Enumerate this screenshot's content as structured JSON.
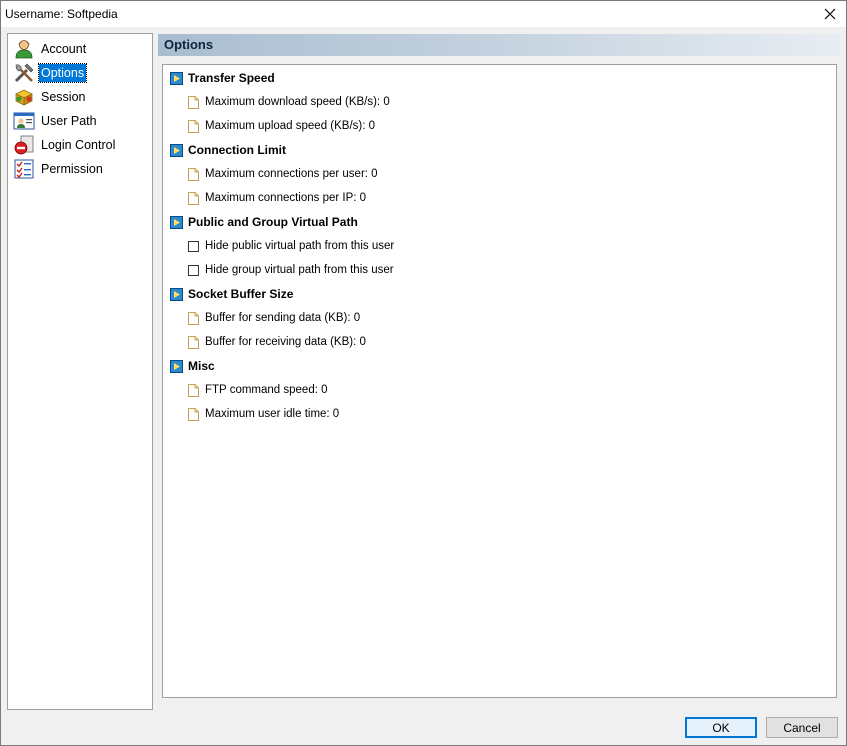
{
  "window": {
    "title": "Username: Softpedia"
  },
  "sidebar": {
    "items": [
      {
        "label": "Account",
        "icon": "user-icon"
      },
      {
        "label": "Options",
        "icon": "tools-icon",
        "selected": true
      },
      {
        "label": "Session",
        "icon": "session-icon"
      },
      {
        "label": "User Path",
        "icon": "folder-user-icon"
      },
      {
        "label": "Login Control",
        "icon": "stop-icon"
      },
      {
        "label": "Permission",
        "icon": "checklist-icon"
      }
    ]
  },
  "header": {
    "title": "Options"
  },
  "sections": [
    {
      "title": "Transfer Speed",
      "rows": [
        {
          "type": "value",
          "label": "Maximum download speed (KB/s): 0"
        },
        {
          "type": "value",
          "label": "Maximum upload speed (KB/s): 0"
        }
      ]
    },
    {
      "title": "Connection Limit",
      "rows": [
        {
          "type": "value",
          "label": "Maximum connections per user: 0"
        },
        {
          "type": "value",
          "label": "Maximum connections per IP: 0"
        }
      ]
    },
    {
      "title": "Public and Group Virtual Path",
      "rows": [
        {
          "type": "checkbox",
          "label": "Hide public virtual path from this user"
        },
        {
          "type": "checkbox",
          "label": "Hide group virtual path from this user"
        }
      ]
    },
    {
      "title": "Socket Buffer Size",
      "rows": [
        {
          "type": "value",
          "label": "Buffer for sending data (KB): 0"
        },
        {
          "type": "value",
          "label": "Buffer for receiving data (KB): 0"
        }
      ]
    },
    {
      "title": "Misc",
      "rows": [
        {
          "type": "value",
          "label": "FTP command speed: 0"
        },
        {
          "type": "value",
          "label": "Maximum user idle time: 0"
        }
      ]
    }
  ],
  "buttons": {
    "ok": "OK",
    "cancel": "Cancel"
  },
  "colors": {
    "accent": "#0078d7",
    "section_icon": "#1f7ab8"
  }
}
